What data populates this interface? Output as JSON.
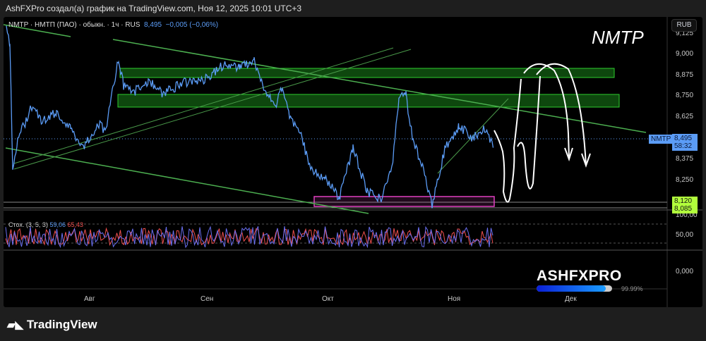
{
  "header": {
    "title": "AshFXPro создал(а) график на TradingView.com, Ноя 12, 2025 10:01 UTC+3"
  },
  "legend": {
    "symbol": "NMTP · НМТП (ПАО) · обыкн. · 1ч · RUS",
    "price": "8,495",
    "change": "−0,005 (−0,06%)"
  },
  "stoch": {
    "label": "Стох. (3, 5, 3)",
    "k": "59,06",
    "d": "65,43"
  },
  "currency": "RUB",
  "price_axis": [
    "9,125",
    "9,000",
    "8,875",
    "8,750",
    "8,625",
    "8,375",
    "8,250"
  ],
  "stoch_axis": [
    "100,00",
    "50,00",
    "0,000"
  ],
  "time_axis": [
    "Авг",
    "Сен",
    "Окт",
    "Ноя",
    "Дек"
  ],
  "price_tag": {
    "symbol": "NMTP",
    "price": "8,495",
    "countdown": "58:32"
  },
  "levels": [
    {
      "value": "8,120"
    },
    {
      "value": "8,085"
    }
  ],
  "annotation_title": "NMTP",
  "watermark": {
    "brand": "ASHFXPRO",
    "progress_pct": 99.99,
    "progress_label": "99.99%"
  },
  "footer": {
    "brand": "TradingView"
  },
  "colors": {
    "price_line": "#5b9cf6",
    "zone": "#1f9e1f",
    "support_zone": "#e040c0",
    "trendline": "#4caf50",
    "level_tag": "#b2ff3c"
  }
}
